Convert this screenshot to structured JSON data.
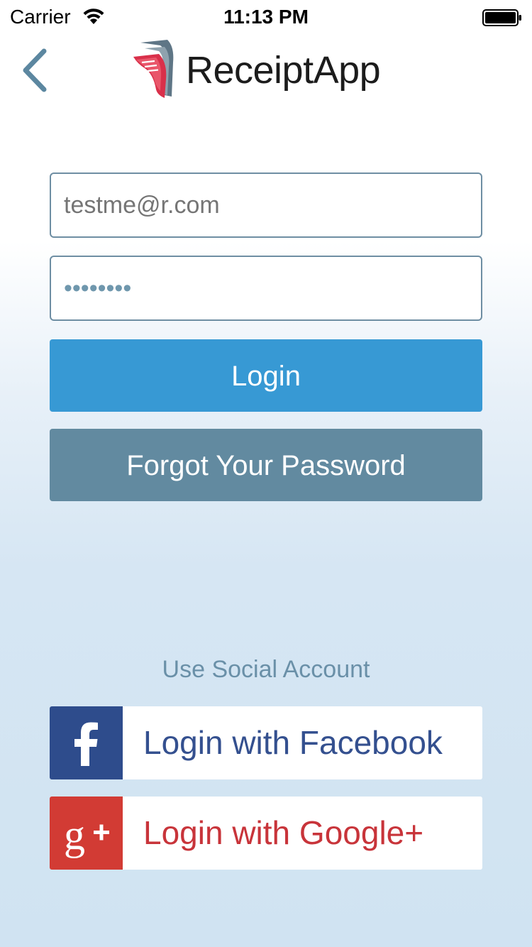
{
  "status_bar": {
    "carrier": "Carrier",
    "time": "11:13 PM",
    "wifi_icon": "wifi-icon",
    "battery_icon": "battery-full-icon"
  },
  "header": {
    "back_icon": "chevron-left-icon",
    "logo_icon": "receipt-logo-icon",
    "app_name": "ReceiptApp"
  },
  "login_form": {
    "email_placeholder": "testme@r.com",
    "password_value": "password",
    "password_masked_length": 8,
    "login_label": "Login",
    "forgot_label": "Forgot Your Password"
  },
  "social": {
    "heading": "Use Social Account",
    "facebook_label": "Login with Facebook",
    "facebook_icon": "facebook-icon",
    "google_label": "Login with Google+",
    "google_icon": "google-plus-icon"
  },
  "colors": {
    "primary_blue": "#3799d4",
    "secondary_slate": "#628aa0",
    "field_border": "#6e8ea3",
    "facebook_blue": "#2e4c8c",
    "google_red": "#d23b34",
    "text_muted": "#6a90a8"
  }
}
